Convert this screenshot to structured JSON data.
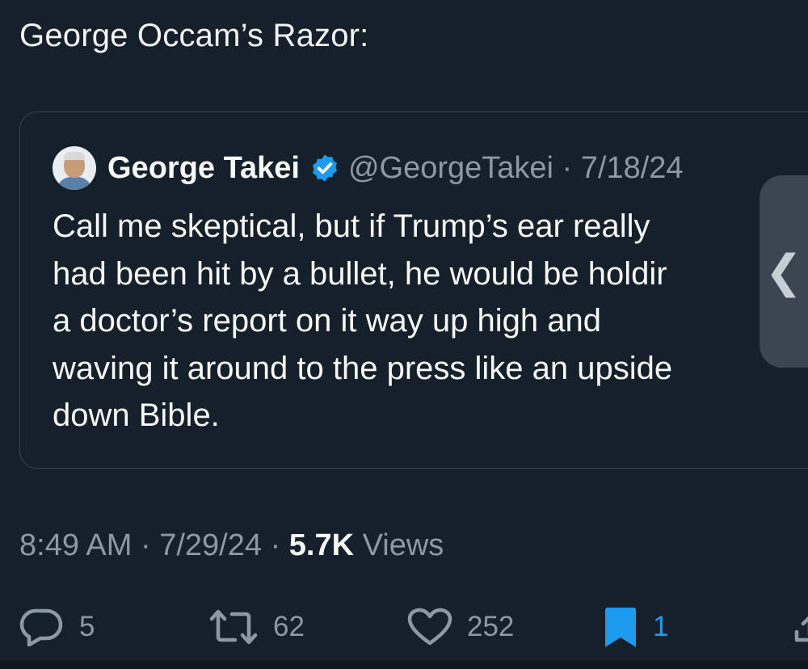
{
  "tweet": {
    "text": "George Occam’s Razor:"
  },
  "quoted": {
    "name": "George Takei",
    "handle_date": "@GeorgeTakei · 7/18/24",
    "lines": [
      "Call me skeptical, but if Trump’s ear really",
      "had been hit by a bullet, he would be holdir",
      "a doctor’s report on it way up high and",
      "waving it around to the press like an upside",
      "down Bible."
    ]
  },
  "side_handle": {
    "glyph": "❮"
  },
  "meta": {
    "time_date": "8:49 AM · 7/29/24 · ",
    "views_count": "5.7K",
    "views_label": " Views"
  },
  "actions": {
    "replies": "5",
    "reposts": "62",
    "likes": "252",
    "bookmarks": "1"
  },
  "colors": {
    "background": "#15202b",
    "accent": "#1d9bf0",
    "muted": "#8b98a5",
    "border": "#38444d"
  },
  "icons": [
    "reply-icon",
    "repost-icon",
    "like-icon",
    "bookmark-icon",
    "share-icon",
    "verified-badge-icon"
  ]
}
